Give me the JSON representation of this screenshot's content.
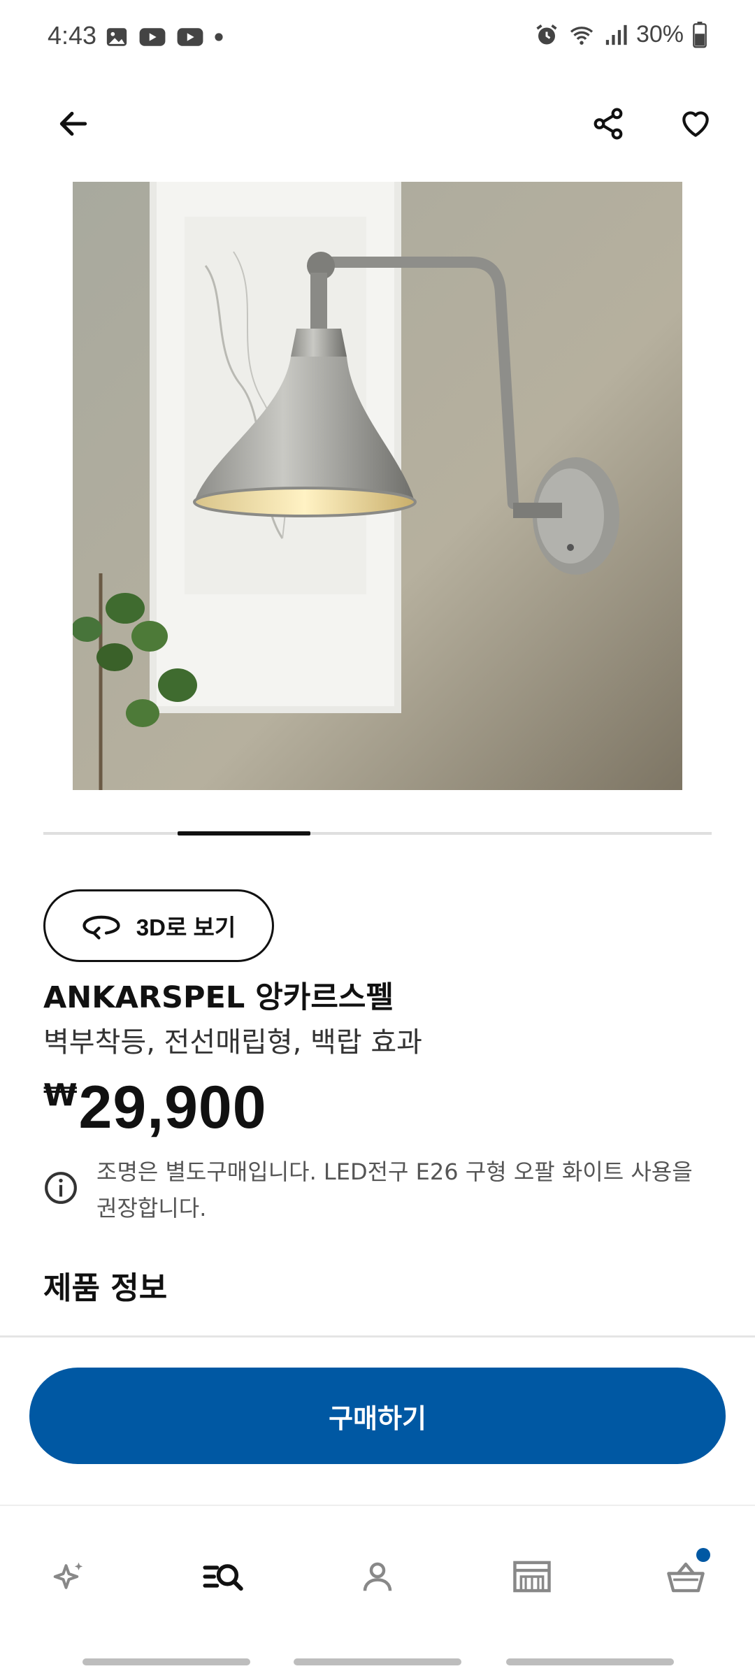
{
  "status_bar": {
    "time": "4:43",
    "battery": "30%"
  },
  "top_bar": {
    "back_icon": "arrow-left-icon",
    "share_icon": "share-icon",
    "favorite_icon": "heart-icon"
  },
  "product": {
    "image_icon": "wall-lamp-photo",
    "carousel_pages": 5,
    "carousel_active_index": 1,
    "view3d_label": "3D로 보기",
    "name": "ANKARSPEL 앙카르스펠",
    "description": "벽부착등, 전선매립형, 백랍 효과",
    "currency_symbol": "₩",
    "price": "29,900",
    "notice": "조명은 별도구매입니다. LED전구 E26 구형 오팔 화이트 사용을 권장합니다.",
    "section_title": "제품 정보"
  },
  "actions": {
    "buy_label": "구매하기"
  },
  "bottom_nav": {
    "items": [
      {
        "name": "inspiration",
        "icon": "sparkle-icon"
      },
      {
        "name": "search",
        "icon": "search-list-icon"
      },
      {
        "name": "profile",
        "icon": "person-icon"
      },
      {
        "name": "store",
        "icon": "store-icon"
      },
      {
        "name": "cart",
        "icon": "basket-icon"
      }
    ]
  },
  "colors": {
    "accent": "#0058a3",
    "text": "#111111",
    "muted": "#555555"
  }
}
